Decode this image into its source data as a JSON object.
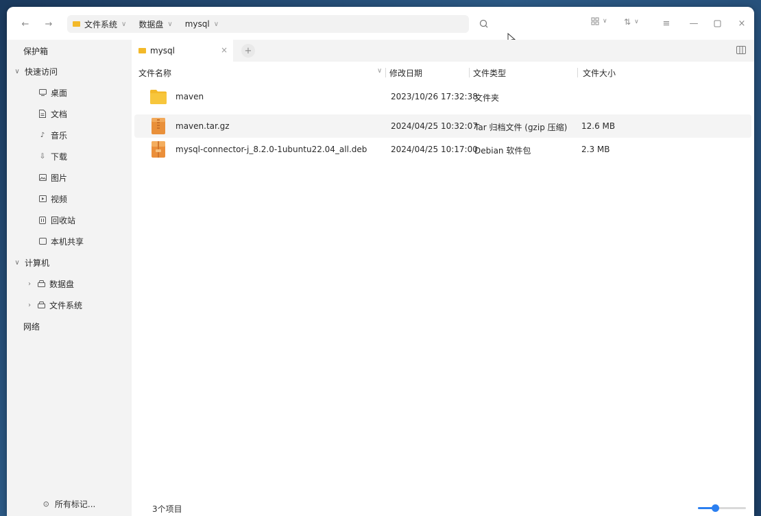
{
  "breadcrumb": [
    {
      "label": "文件系统"
    },
    {
      "label": "数据盘"
    },
    {
      "label": "mysql"
    }
  ],
  "sidebar": {
    "top": "保护箱",
    "quick_access": {
      "label": "快速访问",
      "items": [
        {
          "label": "桌面",
          "icon": "desktop-icon"
        },
        {
          "label": "文档",
          "icon": "document-icon"
        },
        {
          "label": "音乐",
          "icon": "music-icon"
        },
        {
          "label": "下载",
          "icon": "download-icon"
        },
        {
          "label": "图片",
          "icon": "image-icon"
        },
        {
          "label": "视频",
          "icon": "video-icon"
        },
        {
          "label": "回收站",
          "icon": "trash-icon"
        },
        {
          "label": "本机共享",
          "icon": "share-icon"
        }
      ]
    },
    "computer": {
      "label": "计算机",
      "items": [
        {
          "label": "数据盘",
          "icon": "drive-icon"
        },
        {
          "label": "文件系统",
          "icon": "drive-icon"
        }
      ]
    },
    "network": "网络",
    "footer": "所有标记..."
  },
  "tab": {
    "label": "mysql"
  },
  "columns": {
    "name": "文件名称",
    "modified": "修改日期",
    "type": "文件类型",
    "size": "文件大小"
  },
  "files": [
    {
      "name": "maven",
      "modified": "2023/10/26 17:32:38",
      "type": "文件夹",
      "size": "",
      "kind": "folder"
    },
    {
      "name": "maven.tar.gz",
      "modified": "2024/04/25 10:32:07",
      "type": "Tar 归档文件 (gzip 压缩)",
      "size": "12.6 MB",
      "kind": "archive"
    },
    {
      "name": "mysql-connector-j_8.2.0-1ubuntu22.04_all.deb",
      "modified": "2024/04/25 10:17:00",
      "type": "Debian 软件包",
      "size": "2.3 MB",
      "kind": "package"
    }
  ],
  "status": {
    "item_count": "3个项目"
  },
  "zoom": {
    "level": 0.35
  },
  "colors": {
    "accent": "#2b7ff0",
    "folder": "#f3b92a",
    "archive": "#e9903a"
  }
}
